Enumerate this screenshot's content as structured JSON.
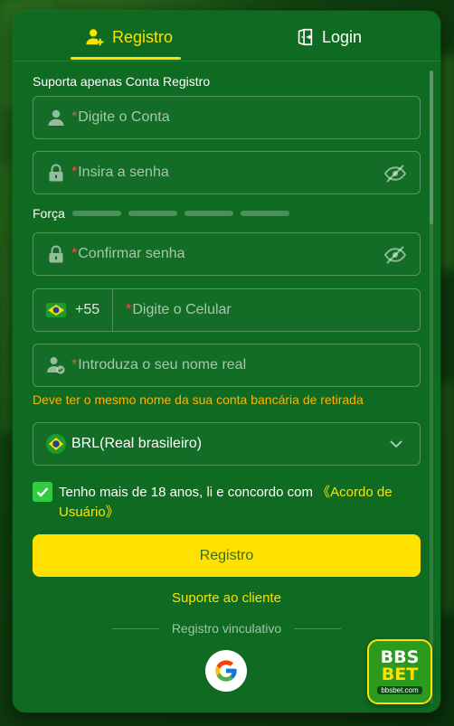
{
  "tabs": {
    "register_label": "Registro",
    "login_label": "Login"
  },
  "form": {
    "support_note": "Suporta apenas Conta Registro",
    "required_mark": "*",
    "account_placeholder": "Digite o Conta",
    "password_placeholder": "Insira a senha",
    "strength_label": "Força",
    "strength_level": 0,
    "confirm_placeholder": "Confirmar senha",
    "phone_code": "+55",
    "phone_placeholder": "Digite o Celular",
    "realname_placeholder": "Introduza o seu nome real",
    "realname_hint": "Deve ter o mesmo nome da sua conta bancária de retirada",
    "currency_value": "BRL(Real brasileiro)",
    "agree_checked": true,
    "agree_text": "Tenho mais de 18 anos, li e concordo com",
    "agree_link": "《Acordo de Usuário》",
    "submit_label": "Registro",
    "support_link": "Suporte ao cliente",
    "divider_text": "Registro vinculativo"
  },
  "brand": {
    "line1": "BBS",
    "line2": "BET",
    "domain": "bbsbet.com"
  },
  "colors": {
    "accent": "#ffe100",
    "panel": "#0f6b22",
    "required": "#ff4d4d",
    "hint": "#ffb300",
    "checkbox": "#2ecc40"
  },
  "icons": [
    "user-add-icon",
    "login-door-icon",
    "user-icon",
    "lock-icon",
    "eye-off-icon",
    "brazil-flag-icon",
    "user-check-icon",
    "chevron-down-icon",
    "check-icon",
    "google-icon"
  ]
}
